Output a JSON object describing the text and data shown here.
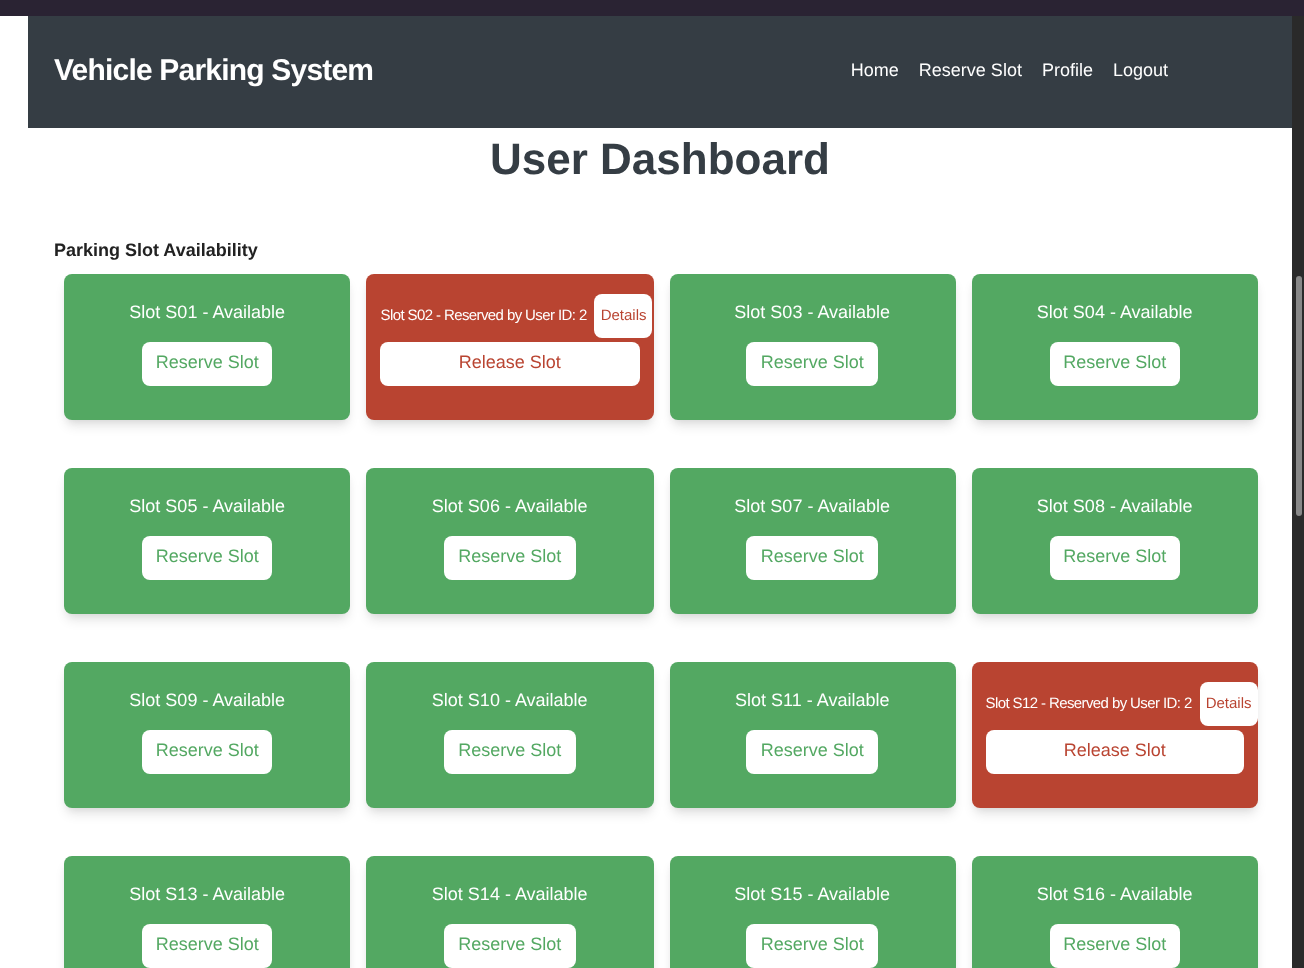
{
  "navbar": {
    "brand": "Vehicle Parking System",
    "links": [
      "Home",
      "Reserve Slot",
      "Profile",
      "Logout"
    ]
  },
  "heading": "User Dashboard",
  "section_title": "Parking Slot Availability",
  "slots": [
    {
      "kind": "available",
      "label": "Slot S01 - Available",
      "action": "Reserve Slot"
    },
    {
      "kind": "reserved",
      "label": "Slot S02 - Reserved by User ID: 2",
      "details": "Details",
      "action": "Release Slot"
    },
    {
      "kind": "available",
      "label": "Slot S03 - Available",
      "action": "Reserve Slot"
    },
    {
      "kind": "available",
      "label": "Slot S04 - Available",
      "action": "Reserve Slot"
    },
    {
      "kind": "available",
      "label": "Slot S05 - Available",
      "action": "Reserve Slot"
    },
    {
      "kind": "available",
      "label": "Slot S06 - Available",
      "action": "Reserve Slot"
    },
    {
      "kind": "available",
      "label": "Slot S07 - Available",
      "action": "Reserve Slot"
    },
    {
      "kind": "available",
      "label": "Slot S08 - Available",
      "action": "Reserve Slot"
    },
    {
      "kind": "available",
      "label": "Slot S09 - Available",
      "action": "Reserve Slot"
    },
    {
      "kind": "available",
      "label": "Slot S10 - Available",
      "action": "Reserve Slot"
    },
    {
      "kind": "available",
      "label": "Slot S11 - Available",
      "action": "Reserve Slot"
    },
    {
      "kind": "reserved",
      "label": "Slot S12 - Reserved by User ID: 2",
      "details": "Details",
      "action": "Release Slot"
    },
    {
      "kind": "available",
      "label": "Slot S13 - Available",
      "action": "Reserve Slot"
    },
    {
      "kind": "available",
      "label": "Slot S14 - Available",
      "action": "Reserve Slot"
    },
    {
      "kind": "available",
      "label": "Slot S15 - Available",
      "action": "Reserve Slot"
    },
    {
      "kind": "available",
      "label": "Slot S16 - Available",
      "action": "Reserve Slot"
    }
  ]
}
